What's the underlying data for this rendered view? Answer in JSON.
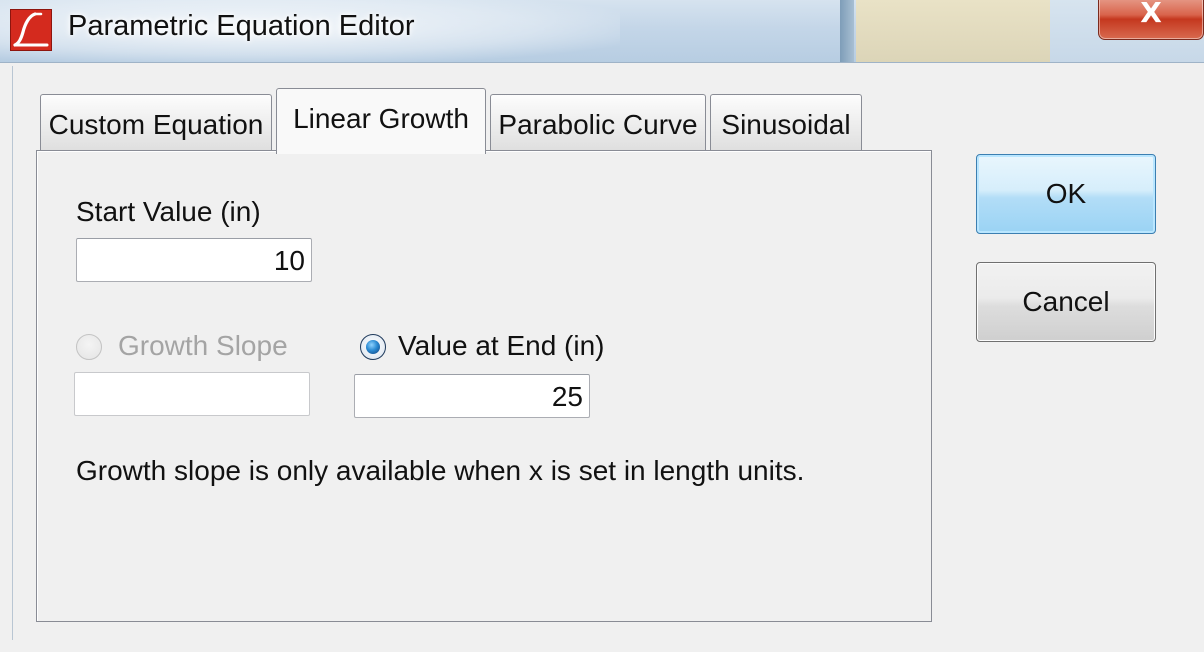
{
  "window": {
    "title": "Parametric Equation Editor",
    "close_glyph": "X"
  },
  "tabs": [
    {
      "label": "Custom Equation",
      "active": false
    },
    {
      "label": "Linear Growth",
      "active": true
    },
    {
      "label": "Parabolic Curve",
      "active": false
    },
    {
      "label": "Sinusoidal",
      "active": false
    }
  ],
  "form": {
    "start_value": {
      "label": "Start Value (in)",
      "value": "10"
    },
    "growth_slope": {
      "label": "Growth Slope",
      "value": "",
      "selected": false,
      "enabled": false
    },
    "value_at_end": {
      "label": "Value at End (in)",
      "value": "25",
      "selected": true,
      "enabled": true
    },
    "note": "Growth slope is only available when x is set in length units."
  },
  "buttons": {
    "ok": "OK",
    "cancel": "Cancel"
  },
  "icons": {
    "app": "app-logo-icon",
    "close": "close-icon",
    "radio_off": "radio-unselected-icon",
    "radio_on": "radio-selected-icon"
  },
  "colors": {
    "accent_red": "#d42a1e",
    "ok_border": "#3c7fb1",
    "disabled_text": "#a4a4a4"
  }
}
